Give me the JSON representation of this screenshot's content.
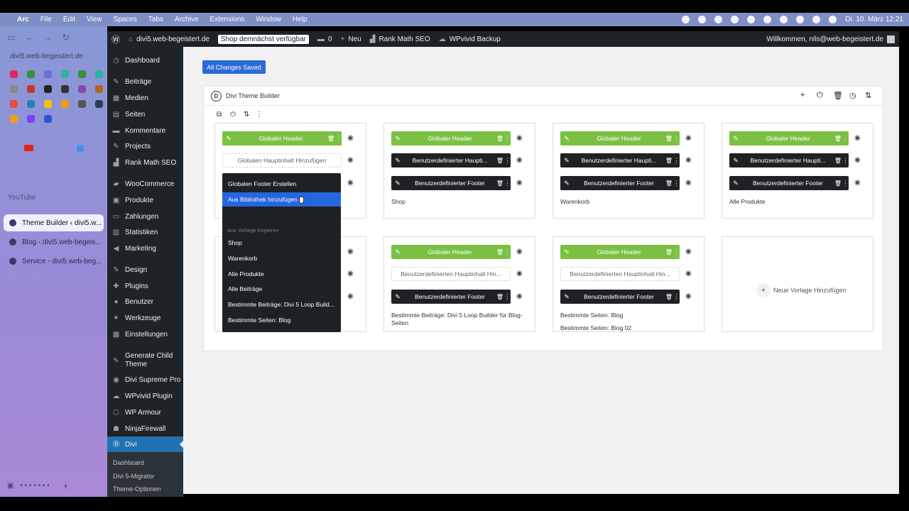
{
  "menubar": {
    "apple": "",
    "app": "Arc",
    "items": [
      "File",
      "Edit",
      "View",
      "Spaces",
      "Tabs",
      "Archive",
      "Extensions",
      "Window",
      "Help"
    ],
    "datetime": "Di. 10. März  12:21"
  },
  "arc": {
    "url": "divi5.web-begeistert.de",
    "youtube_label": "YouTube",
    "new_tab": "+ New Tab",
    "tabs": [
      {
        "title": "Theme Builder ‹ divi5.w..."
      },
      {
        "title": "Blog - divi5.web-begeis..."
      },
      {
        "title": "Service - divi5.web-beg..."
      }
    ],
    "fav_colors": [
      "#e0245e",
      "#3b8f3b",
      "#6f6fd8",
      "#2bb3a3",
      "#3b8f3b",
      "#2bb3a3",
      "#888",
      "#c0392b",
      "#222",
      "#333",
      "#8e44ad",
      "#b5651d",
      "#e74c3c",
      "#2980b9",
      "#f1c40f",
      "#f39c12",
      "#555",
      "#2c3e50",
      "#f39c12",
      "#7d3cff",
      "#2855d6"
    ]
  },
  "adminbar": {
    "site": "divi5.web-begeistert.de",
    "badge": "Shop demnächst verfügbar",
    "comments": "0",
    "new": "Neu",
    "rankmath": "Rank Math SEO",
    "wpvivid": "WPvivid Backup",
    "welcome": "Willkommen, nils@web-begeistert.de"
  },
  "wpmenu": {
    "items": [
      {
        "label": "Dashboard",
        "icon": "dashboard-icon"
      },
      {
        "label": "Beiträge",
        "icon": "pin-icon"
      },
      {
        "label": "Medien",
        "icon": "media-icon"
      },
      {
        "label": "Seiten",
        "icon": "page-icon"
      },
      {
        "label": "Kommentare",
        "icon": "comment-icon"
      },
      {
        "label": "Projects",
        "icon": "pin-icon"
      },
      {
        "label": "Rank Math SEO",
        "icon": "rankmath-icon"
      },
      {
        "label": "WooCommerce",
        "icon": "woo-icon"
      },
      {
        "label": "Produkte",
        "icon": "box-icon"
      },
      {
        "label": "Zahlungen",
        "icon": "card-icon"
      },
      {
        "label": "Statistiken",
        "icon": "chart-icon"
      },
      {
        "label": "Marketing",
        "icon": "megaphone-icon"
      },
      {
        "label": "Design",
        "icon": "brush-icon"
      },
      {
        "label": "Plugins",
        "icon": "plug-icon"
      },
      {
        "label": "Benutzer",
        "icon": "user-icon"
      },
      {
        "label": "Werkzeuge",
        "icon": "wrench-icon"
      },
      {
        "label": "Einstellungen",
        "icon": "settings-icon"
      },
      {
        "label": "Generate Child Theme",
        "icon": "brush-icon"
      },
      {
        "label": "Divi Supreme Pro",
        "icon": "divi-icon"
      },
      {
        "label": "WPvivid Plugin",
        "icon": "cloud-icon"
      },
      {
        "label": "WP Armour",
        "icon": "shield-icon"
      },
      {
        "label": "NinjaFirewall",
        "icon": "ninja-icon"
      },
      {
        "label": "Divi",
        "icon": "divi-icon"
      }
    ],
    "submenu": [
      "Dashboard",
      "Divi 5-Migrator",
      "Theme-Optionen"
    ]
  },
  "main": {
    "saved_button": "All Changes Saved",
    "builder_title": "Divi Theme Builder",
    "cards": [
      {
        "rows": [
          {
            "type": "g",
            "label": "Globaler Header"
          },
          {
            "type": "e",
            "label": "Globalen Hauptinhalt Hinzufügen"
          }
        ],
        "labels": []
      },
      {
        "rows": [
          {
            "type": "g",
            "label": "Globaler Header"
          },
          {
            "type": "d",
            "label": "Benutzerdefinierter Haupti..."
          },
          {
            "type": "d",
            "label": "Benutzerdefinierter Footer"
          }
        ],
        "labels": [
          "Shop"
        ]
      },
      {
        "rows": [
          {
            "type": "g",
            "label": "Globaler Header"
          },
          {
            "type": "d",
            "label": "Benutzerdefinierter Haupti..."
          },
          {
            "type": "d",
            "label": "Benutzerdefinierter Footer"
          }
        ],
        "labels": [
          "Warenkorb"
        ]
      },
      {
        "rows": [
          {
            "type": "g",
            "label": "Globaler Header"
          },
          {
            "type": "d",
            "label": "Benutzerdefinierter Haupti..."
          },
          {
            "type": "d",
            "label": "Benutzerdefinierter Footer"
          }
        ],
        "labels": [
          "Alle Produkte"
        ]
      },
      {
        "rows": [],
        "labels": []
      },
      {
        "rows": [
          {
            "type": "g",
            "label": "Globaler Header"
          },
          {
            "type": "e",
            "label": "Benutzerdefinierten Hauptinhalt Hin..."
          },
          {
            "type": "d",
            "label": "Benutzerdefinierter Footer"
          }
        ],
        "labels": [
          "Bestimmte Beiträge: Divi 5 Loop Builder für Blog-Seiten"
        ]
      },
      {
        "rows": [
          {
            "type": "g",
            "label": "Globaler Header"
          },
          {
            "type": "e",
            "label": "Benutzerdefinierten Hauptinhalt Hin..."
          },
          {
            "type": "d",
            "label": "Benutzerdefinierter Footer"
          }
        ],
        "labels": [
          "Bestimmte Seiten: Blog",
          "Bestimmte Seiten: Blog 02"
        ]
      },
      {
        "rows": [],
        "labels": [],
        "add_label": "Neue Vorlage Hinzufügen"
      }
    ]
  },
  "dropdown": {
    "items": [
      "Globalen Footer Erstellen",
      "Aus Bibliothek hinzufügen"
    ],
    "section": "Aus Vorlage Kopieren",
    "templates": [
      "Shop",
      "Warenkorb",
      "Alle Produkte",
      "Alle Beiträge",
      "Bestimmte Beiträge: Divi 5 Loop Build...",
      "Bestimmte Seiten: Blog"
    ]
  }
}
